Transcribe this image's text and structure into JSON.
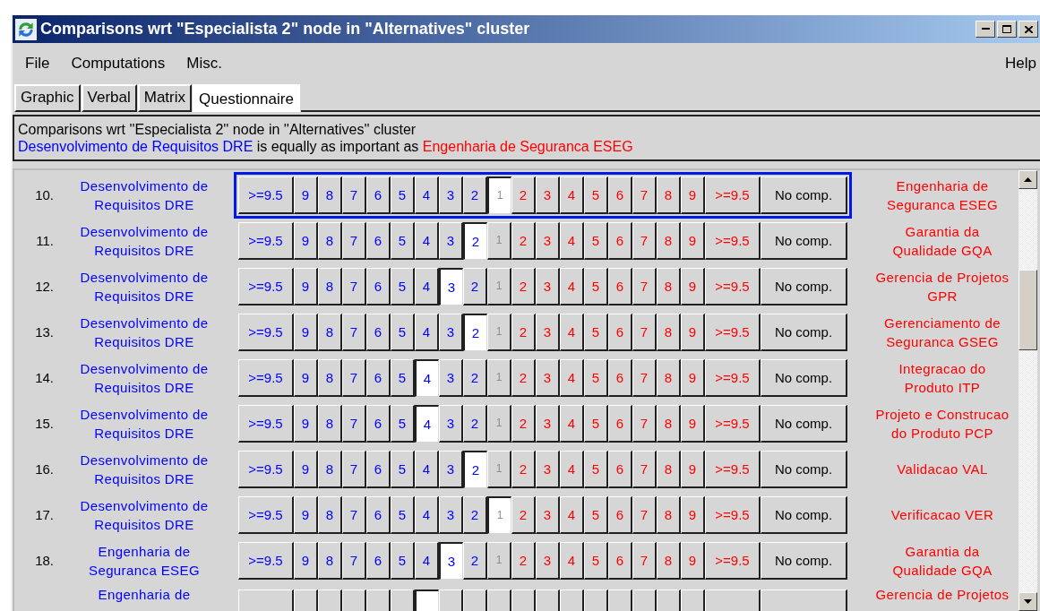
{
  "window": {
    "title": "Comparisons wrt \"Especialista 2\" node in \"Alternatives\" cluster"
  },
  "menu": {
    "items": [
      "File",
      "Computations",
      "Misc."
    ],
    "help": "Help"
  },
  "tabs": [
    {
      "label": "Graphic",
      "selected": false
    },
    {
      "label": "Verbal",
      "selected": false
    },
    {
      "label": "Matrix",
      "selected": false
    },
    {
      "label": "Questionnaire",
      "selected": true
    }
  ],
  "info": {
    "line1": "Comparisons wrt ''Especialista 2'' node in ''Alternatives'' cluster",
    "left": "Desenvolvimento de Requisitos DRE",
    "middle": " is equally as important as ",
    "right": "Engenharia de Seguranca ESEG"
  },
  "rows": [
    {
      "kind": "full",
      "number": "10.",
      "left": [
        "Desenvolvimento de",
        "Requisitos DRE"
      ],
      "right": [
        "Engenharia de",
        "Seguranca ESEG"
      ],
      "focused": true,
      "buttons": [
        {
          "label": ">=9.5",
          "kind": "left",
          "selected": false
        },
        {
          "label": "9",
          "kind": "left",
          "selected": false
        },
        {
          "label": "8",
          "kind": "left",
          "selected": false
        },
        {
          "label": "7",
          "kind": "left",
          "selected": false
        },
        {
          "label": "6",
          "kind": "left",
          "selected": false
        },
        {
          "label": "5",
          "kind": "left",
          "selected": false
        },
        {
          "label": "4",
          "kind": "left",
          "selected": false
        },
        {
          "label": "3",
          "kind": "left",
          "selected": false
        },
        {
          "label": "2",
          "kind": "left",
          "selected": false
        },
        {
          "label": "1",
          "kind": "equal",
          "selected": true
        },
        {
          "label": "2",
          "kind": "right",
          "selected": false
        },
        {
          "label": "3",
          "kind": "right",
          "selected": false
        },
        {
          "label": "4",
          "kind": "right",
          "selected": false
        },
        {
          "label": "5",
          "kind": "right",
          "selected": false
        },
        {
          "label": "6",
          "kind": "right",
          "selected": false
        },
        {
          "label": "7",
          "kind": "right",
          "selected": false
        },
        {
          "label": "8",
          "kind": "right",
          "selected": false
        },
        {
          "label": "9",
          "kind": "right",
          "selected": false
        },
        {
          "label": ">=9.5",
          "kind": "right",
          "selected": false
        },
        {
          "label": "No comp.",
          "kind": "none",
          "selected": false
        }
      ]
    },
    {
      "kind": "full",
      "number": "11.",
      "left": [
        "Desenvolvimento de",
        "Requisitos DRE"
      ],
      "right": [
        "Garantia da",
        "Qualidade GQA"
      ],
      "focused": false,
      "buttons": [
        {
          "label": ">=9.5",
          "kind": "left",
          "selected": false
        },
        {
          "label": "9",
          "kind": "left",
          "selected": false
        },
        {
          "label": "8",
          "kind": "left",
          "selected": false
        },
        {
          "label": "7",
          "kind": "left",
          "selected": false
        },
        {
          "label": "6",
          "kind": "left",
          "selected": false
        },
        {
          "label": "5",
          "kind": "left",
          "selected": false
        },
        {
          "label": "4",
          "kind": "left",
          "selected": false
        },
        {
          "label": "3",
          "kind": "left",
          "selected": false
        },
        {
          "label": "2",
          "kind": "left",
          "selected": true
        },
        {
          "label": "1",
          "kind": "equal",
          "selected": false
        },
        {
          "label": "2",
          "kind": "right",
          "selected": false
        },
        {
          "label": "3",
          "kind": "right",
          "selected": false
        },
        {
          "label": "4",
          "kind": "right",
          "selected": false
        },
        {
          "label": "5",
          "kind": "right",
          "selected": false
        },
        {
          "label": "6",
          "kind": "right",
          "selected": false
        },
        {
          "label": "7",
          "kind": "right",
          "selected": false
        },
        {
          "label": "8",
          "kind": "right",
          "selected": false
        },
        {
          "label": "9",
          "kind": "right",
          "selected": false
        },
        {
          "label": ">=9.5",
          "kind": "right",
          "selected": false
        },
        {
          "label": "No comp.",
          "kind": "none",
          "selected": false
        }
      ]
    },
    {
      "kind": "full",
      "number": "12.",
      "left": [
        "Desenvolvimento de",
        "Requisitos DRE"
      ],
      "right": [
        "Gerencia de Projetos",
        "GPR"
      ],
      "focused": false,
      "buttons": [
        {
          "label": ">=9.5",
          "kind": "left",
          "selected": false
        },
        {
          "label": "9",
          "kind": "left",
          "selected": false
        },
        {
          "label": "8",
          "kind": "left",
          "selected": false
        },
        {
          "label": "7",
          "kind": "left",
          "selected": false
        },
        {
          "label": "6",
          "kind": "left",
          "selected": false
        },
        {
          "label": "5",
          "kind": "left",
          "selected": false
        },
        {
          "label": "4",
          "kind": "left",
          "selected": false
        },
        {
          "label": "3",
          "kind": "left",
          "selected": true
        },
        {
          "label": "2",
          "kind": "left",
          "selected": false
        },
        {
          "label": "1",
          "kind": "equal",
          "selected": false
        },
        {
          "label": "2",
          "kind": "right",
          "selected": false
        },
        {
          "label": "3",
          "kind": "right",
          "selected": false
        },
        {
          "label": "4",
          "kind": "right",
          "selected": false
        },
        {
          "label": "5",
          "kind": "right",
          "selected": false
        },
        {
          "label": "6",
          "kind": "right",
          "selected": false
        },
        {
          "label": "7",
          "kind": "right",
          "selected": false
        },
        {
          "label": "8",
          "kind": "right",
          "selected": false
        },
        {
          "label": "9",
          "kind": "right",
          "selected": false
        },
        {
          "label": ">=9.5",
          "kind": "right",
          "selected": false
        },
        {
          "label": "No comp.",
          "kind": "none",
          "selected": false
        }
      ]
    },
    {
      "kind": "full",
      "number": "13.",
      "left": [
        "Desenvolvimento de",
        "Requisitos DRE"
      ],
      "right": [
        "Gerenciamento de",
        "Seguranca GSEG"
      ],
      "focused": false,
      "buttons": [
        {
          "label": ">=9.5",
          "kind": "left",
          "selected": false
        },
        {
          "label": "9",
          "kind": "left",
          "selected": false
        },
        {
          "label": "8",
          "kind": "left",
          "selected": false
        },
        {
          "label": "7",
          "kind": "left",
          "selected": false
        },
        {
          "label": "6",
          "kind": "left",
          "selected": false
        },
        {
          "label": "5",
          "kind": "left",
          "selected": false
        },
        {
          "label": "4",
          "kind": "left",
          "selected": false
        },
        {
          "label": "3",
          "kind": "left",
          "selected": false
        },
        {
          "label": "2",
          "kind": "left",
          "selected": true
        },
        {
          "label": "1",
          "kind": "equal",
          "selected": false
        },
        {
          "label": "2",
          "kind": "right",
          "selected": false
        },
        {
          "label": "3",
          "kind": "right",
          "selected": false
        },
        {
          "label": "4",
          "kind": "right",
          "selected": false
        },
        {
          "label": "5",
          "kind": "right",
          "selected": false
        },
        {
          "label": "6",
          "kind": "right",
          "selected": false
        },
        {
          "label": "7",
          "kind": "right",
          "selected": false
        },
        {
          "label": "8",
          "kind": "right",
          "selected": false
        },
        {
          "label": "9",
          "kind": "right",
          "selected": false
        },
        {
          "label": ">=9.5",
          "kind": "right",
          "selected": false
        },
        {
          "label": "No comp.",
          "kind": "none",
          "selected": false
        }
      ]
    },
    {
      "kind": "full",
      "number": "14.",
      "left": [
        "Desenvolvimento de",
        "Requisitos DRE"
      ],
      "right": [
        "Integracao do",
        "Produto ITP"
      ],
      "focused": false,
      "buttons": [
        {
          "label": ">=9.5",
          "kind": "left",
          "selected": false
        },
        {
          "label": "9",
          "kind": "left",
          "selected": false
        },
        {
          "label": "8",
          "kind": "left",
          "selected": false
        },
        {
          "label": "7",
          "kind": "left",
          "selected": false
        },
        {
          "label": "6",
          "kind": "left",
          "selected": false
        },
        {
          "label": "5",
          "kind": "left",
          "selected": false
        },
        {
          "label": "4",
          "kind": "left",
          "selected": true
        },
        {
          "label": "3",
          "kind": "left",
          "selected": false
        },
        {
          "label": "2",
          "kind": "left",
          "selected": false
        },
        {
          "label": "1",
          "kind": "equal",
          "selected": false
        },
        {
          "label": "2",
          "kind": "right",
          "selected": false
        },
        {
          "label": "3",
          "kind": "right",
          "selected": false
        },
        {
          "label": "4",
          "kind": "right",
          "selected": false
        },
        {
          "label": "5",
          "kind": "right",
          "selected": false
        },
        {
          "label": "6",
          "kind": "right",
          "selected": false
        },
        {
          "label": "7",
          "kind": "right",
          "selected": false
        },
        {
          "label": "8",
          "kind": "right",
          "selected": false
        },
        {
          "label": "9",
          "kind": "right",
          "selected": false
        },
        {
          "label": ">=9.5",
          "kind": "right",
          "selected": false
        },
        {
          "label": "No comp.",
          "kind": "none",
          "selected": false
        }
      ]
    },
    {
      "kind": "full",
      "number": "15.",
      "left": [
        "Desenvolvimento de",
        "Requisitos DRE"
      ],
      "right": [
        "Projeto e Construcao",
        "do Produto PCP"
      ],
      "focused": false,
      "buttons": [
        {
          "label": ">=9.5",
          "kind": "left",
          "selected": false
        },
        {
          "label": "9",
          "kind": "left",
          "selected": false
        },
        {
          "label": "8",
          "kind": "left",
          "selected": false
        },
        {
          "label": "7",
          "kind": "left",
          "selected": false
        },
        {
          "label": "6",
          "kind": "left",
          "selected": false
        },
        {
          "label": "5",
          "kind": "left",
          "selected": false
        },
        {
          "label": "4",
          "kind": "left",
          "selected": true
        },
        {
          "label": "3",
          "kind": "left",
          "selected": false
        },
        {
          "label": "2",
          "kind": "left",
          "selected": false
        },
        {
          "label": "1",
          "kind": "equal",
          "selected": false
        },
        {
          "label": "2",
          "kind": "right",
          "selected": false
        },
        {
          "label": "3",
          "kind": "right",
          "selected": false
        },
        {
          "label": "4",
          "kind": "right",
          "selected": false
        },
        {
          "label": "5",
          "kind": "right",
          "selected": false
        },
        {
          "label": "6",
          "kind": "right",
          "selected": false
        },
        {
          "label": "7",
          "kind": "right",
          "selected": false
        },
        {
          "label": "8",
          "kind": "right",
          "selected": false
        },
        {
          "label": "9",
          "kind": "right",
          "selected": false
        },
        {
          "label": ">=9.5",
          "kind": "right",
          "selected": false
        },
        {
          "label": "No comp.",
          "kind": "none",
          "selected": false
        }
      ]
    },
    {
      "kind": "full",
      "number": "16.",
      "left": [
        "Desenvolvimento de",
        "Requisitos DRE"
      ],
      "right": [
        "Validacao VAL"
      ],
      "focused": false,
      "buttons": [
        {
          "label": ">=9.5",
          "kind": "left",
          "selected": false
        },
        {
          "label": "9",
          "kind": "left",
          "selected": false
        },
        {
          "label": "8",
          "kind": "left",
          "selected": false
        },
        {
          "label": "7",
          "kind": "left",
          "selected": false
        },
        {
          "label": "6",
          "kind": "left",
          "selected": false
        },
        {
          "label": "5",
          "kind": "left",
          "selected": false
        },
        {
          "label": "4",
          "kind": "left",
          "selected": false
        },
        {
          "label": "3",
          "kind": "left",
          "selected": false
        },
        {
          "label": "2",
          "kind": "left",
          "selected": true
        },
        {
          "label": "1",
          "kind": "equal",
          "selected": false
        },
        {
          "label": "2",
          "kind": "right",
          "selected": false
        },
        {
          "label": "3",
          "kind": "right",
          "selected": false
        },
        {
          "label": "4",
          "kind": "right",
          "selected": false
        },
        {
          "label": "5",
          "kind": "right",
          "selected": false
        },
        {
          "label": "6",
          "kind": "right",
          "selected": false
        },
        {
          "label": "7",
          "kind": "right",
          "selected": false
        },
        {
          "label": "8",
          "kind": "right",
          "selected": false
        },
        {
          "label": "9",
          "kind": "right",
          "selected": false
        },
        {
          "label": ">=9.5",
          "kind": "right",
          "selected": false
        },
        {
          "label": "No comp.",
          "kind": "none",
          "selected": false
        }
      ]
    },
    {
      "kind": "full",
      "number": "17.",
      "left": [
        "Desenvolvimento de",
        "Requisitos DRE"
      ],
      "right": [
        "Verificacao VER"
      ],
      "focused": false,
      "buttons": [
        {
          "label": ">=9.5",
          "kind": "left",
          "selected": false
        },
        {
          "label": "9",
          "kind": "left",
          "selected": false
        },
        {
          "label": "8",
          "kind": "left",
          "selected": false
        },
        {
          "label": "7",
          "kind": "left",
          "selected": false
        },
        {
          "label": "6",
          "kind": "left",
          "selected": false
        },
        {
          "label": "5",
          "kind": "left",
          "selected": false
        },
        {
          "label": "4",
          "kind": "left",
          "selected": false
        },
        {
          "label": "3",
          "kind": "left",
          "selected": false
        },
        {
          "label": "2",
          "kind": "left",
          "selected": false
        },
        {
          "label": "1",
          "kind": "equal",
          "selected": true
        },
        {
          "label": "2",
          "kind": "right",
          "selected": false
        },
        {
          "label": "3",
          "kind": "right",
          "selected": false
        },
        {
          "label": "4",
          "kind": "right",
          "selected": false
        },
        {
          "label": "5",
          "kind": "right",
          "selected": false
        },
        {
          "label": "6",
          "kind": "right",
          "selected": false
        },
        {
          "label": "7",
          "kind": "right",
          "selected": false
        },
        {
          "label": "8",
          "kind": "right",
          "selected": false
        },
        {
          "label": "9",
          "kind": "right",
          "selected": false
        },
        {
          "label": ">=9.5",
          "kind": "right",
          "selected": false
        },
        {
          "label": "No comp.",
          "kind": "none",
          "selected": false
        }
      ]
    },
    {
      "kind": "full",
      "number": "18.",
      "left": [
        "Engenharia de",
        "Seguranca ESEG"
      ],
      "right": [
        "Garantia da",
        "Qualidade GQA"
      ],
      "focused": false,
      "buttons": [
        {
          "label": ">=9.5",
          "kind": "left",
          "selected": false
        },
        {
          "label": "9",
          "kind": "left",
          "selected": false
        },
        {
          "label": "8",
          "kind": "left",
          "selected": false
        },
        {
          "label": "7",
          "kind": "left",
          "selected": false
        },
        {
          "label": "6",
          "kind": "left",
          "selected": false
        },
        {
          "label": "5",
          "kind": "left",
          "selected": false
        },
        {
          "label": "4",
          "kind": "left",
          "selected": false
        },
        {
          "label": "3",
          "kind": "left",
          "selected": true
        },
        {
          "label": "2",
          "kind": "left",
          "selected": false
        },
        {
          "label": "1",
          "kind": "equal",
          "selected": false
        },
        {
          "label": "2",
          "kind": "right",
          "selected": false
        },
        {
          "label": "3",
          "kind": "right",
          "selected": false
        },
        {
          "label": "4",
          "kind": "right",
          "selected": false
        },
        {
          "label": "5",
          "kind": "right",
          "selected": false
        },
        {
          "label": "6",
          "kind": "right",
          "selected": false
        },
        {
          "label": "7",
          "kind": "right",
          "selected": false
        },
        {
          "label": "8",
          "kind": "right",
          "selected": false
        },
        {
          "label": "9",
          "kind": "right",
          "selected": false
        },
        {
          "label": ">=9.5",
          "kind": "right",
          "selected": false
        },
        {
          "label": "No comp.",
          "kind": "none",
          "selected": false
        }
      ]
    },
    {
      "kind": "cut",
      "left": [
        "Engenharia de"
      ],
      "right": [
        "Gerencia de Projetos"
      ],
      "buttons": [
        {
          "kind": "left",
          "selected": false
        },
        {
          "kind": "left",
          "selected": false
        },
        {
          "kind": "left",
          "selected": false
        },
        {
          "kind": "left",
          "selected": false
        },
        {
          "kind": "left",
          "selected": false
        },
        {
          "kind": "left",
          "selected": false
        },
        {
          "kind": "left",
          "selected": true
        },
        {
          "kind": "left",
          "selected": false
        },
        {
          "kind": "left",
          "selected": false
        },
        {
          "kind": "equal",
          "selected": false
        },
        {
          "kind": "right",
          "selected": false
        },
        {
          "kind": "right",
          "selected": false
        },
        {
          "kind": "right",
          "selected": false
        },
        {
          "kind": "right",
          "selected": false
        },
        {
          "kind": "right",
          "selected": false
        },
        {
          "kind": "right",
          "selected": false
        },
        {
          "kind": "right",
          "selected": false
        },
        {
          "kind": "right",
          "selected": false
        },
        {
          "kind": "right",
          "selected": false
        },
        {
          "kind": "none",
          "selected": false
        }
      ]
    }
  ]
}
